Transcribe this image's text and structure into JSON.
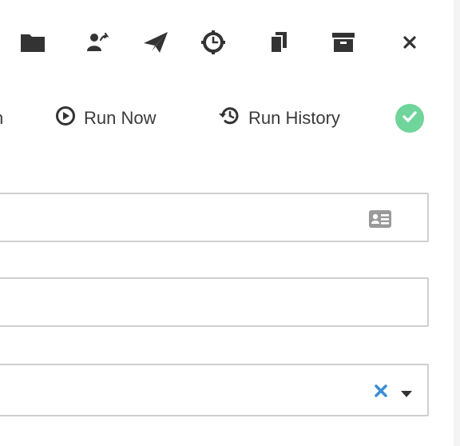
{
  "toolbar": {
    "icons": [
      {
        "name": "folder-icon"
      },
      {
        "name": "share-user-icon"
      },
      {
        "name": "paper-plane-icon"
      },
      {
        "name": "clock-icon"
      },
      {
        "name": "copy-icon"
      },
      {
        "name": "archive-icon"
      },
      {
        "name": "close-icon"
      }
    ]
  },
  "actions": {
    "clipped_label": "n",
    "run_now_label": "Run Now",
    "run_history_label": "Run History"
  },
  "form": {
    "field1_value": "",
    "field2_value": "",
    "field3_value": ""
  },
  "colors": {
    "status_success": "#6fd59a",
    "clear_icon": "#3b8fd6",
    "icon_dark": "#333333",
    "icon_muted": "#9a9a9a",
    "border": "#cfcfcf"
  }
}
